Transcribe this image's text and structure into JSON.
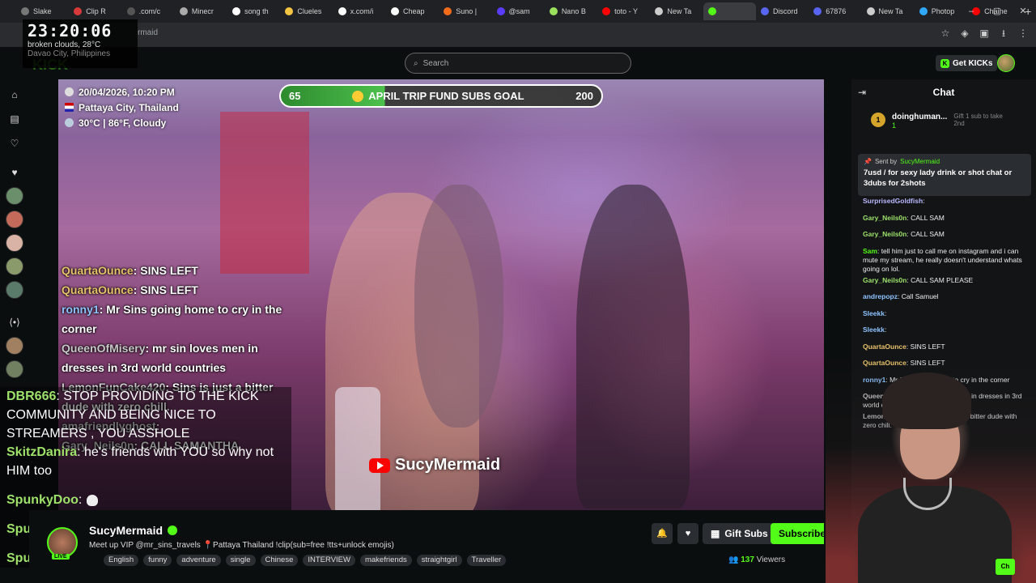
{
  "browser": {
    "tabs": [
      {
        "label": "Slake",
        "color": "#777"
      },
      {
        "label": "Clip R",
        "color": "#d63a3a"
      },
      {
        "label": ".com/c",
        "color": "#555"
      },
      {
        "label": "Minecr",
        "color": "#aaa"
      },
      {
        "label": "song th",
        "color": "#fff"
      },
      {
        "label": "Clueles",
        "color": "#f4c542"
      },
      {
        "label": "x.com/i",
        "color": "#fff"
      },
      {
        "label": "Cheap",
        "color": "#fff"
      },
      {
        "label": "Suno |",
        "color": "#f46b1a"
      },
      {
        "label": "@sam",
        "color": "#5b3cff"
      },
      {
        "label": "Nano B",
        "color": "#9be15d"
      },
      {
        "label": "toto - Y",
        "color": "#ff0000"
      },
      {
        "label": "New Ta",
        "color": "#ccc"
      },
      {
        "label": "",
        "color": "#53fc18"
      },
      {
        "label": "Discord",
        "color": "#5865f2"
      },
      {
        "label": "67876",
        "color": "#5865f2"
      },
      {
        "label": "New Ta",
        "color": "#ccc"
      },
      {
        "label": "Photop",
        "color": "#31a8ff"
      },
      {
        "label": "Chaine",
        "color": "#ff0000"
      }
    ],
    "url": "rmaid",
    "window_controls": [
      "–",
      "▢",
      "✕"
    ]
  },
  "clock": {
    "time": "23:20:06",
    "weather": "broken clouds, 28°C",
    "city": "Davao City, Philippines"
  },
  "site": {
    "logo": "KICK",
    "search_placeholder": "Search",
    "get_kicks": "Get KICKs"
  },
  "stream_overlay": {
    "date": "20/04/2026, 10:20 PM",
    "location": "Pattaya City, Thailand",
    "weather": "30°C | 86°F, Cloudy",
    "goal": {
      "current": "65",
      "label": "APRIL TRIP FUND SUBS GOAL",
      "target": "200",
      "progress": 0.325
    },
    "chat": [
      {
        "user": "QuartaOunce",
        "text": ": SINS LEFT",
        "cls": "n1"
      },
      {
        "user": "QuartaOunce",
        "text": ": SINS LEFT",
        "cls": "n1"
      },
      {
        "user": "ronny1",
        "text": ": Mr Sins going home to cry in the corner",
        "cls": "n2"
      },
      {
        "user": "QueenOfMisery",
        "text": ": mr sin loves men in dresses in 3rd world countries",
        "cls": "n3"
      },
      {
        "user": "LemonFunCake420",
        "text": ": Sins is just a bitter dude with zero chill.",
        "cls": "n3"
      },
      {
        "user": "amafriendlyghost",
        "text": ":",
        "cls": "n3"
      },
      {
        "user": "Gary_Neils0n",
        "text": ": CALL SAMANTHA",
        "cls": "n3"
      }
    ],
    "watermark": "SucyMermaid"
  },
  "external_chat": [
    {
      "user": "DBR666",
      "text": ": STOP PROVIDING TO THE KICK COMMUNITY AND BEING NICE TO STREAMERS , YOU ASSHOLE"
    },
    {
      "user": "SkitzDanira",
      "text": ": he's friends with YOU so why not HIM too"
    },
    {
      "user": "SpunkyDoo",
      "text": ":"
    },
    {
      "user": "SpunkyDoo",
      "text": ":"
    },
    {
      "user": "SpunkyDoo",
      "text": ":"
    }
  ],
  "stream_info": {
    "streamer": "SucyMermaid",
    "live": "LIVE",
    "title": "Meet up VIP @mr_sins_travels 📍Pattaya Thailand !clip(sub=free !tts+unlock emojis)",
    "tags": [
      "English",
      "funny",
      "adventure",
      "single",
      "Chinese",
      "INTERVIEW",
      "makefriends",
      "straightgirl",
      "Traveller"
    ],
    "gift_subs": "Gift Subs",
    "subscribe": "Subscribe",
    "viewers_count": "137",
    "viewers_label": " Viewers"
  },
  "chat": {
    "title": "Chat",
    "leaderboard": {
      "rank": "1",
      "user": "doinghuman...",
      "count": "1",
      "gift_text": "Gift 1 sub to take 2nd"
    },
    "pinned": {
      "sent_by": "Sent by",
      "sender": "SucyMermaid",
      "message": "7usd / for sexy lady drink or shot chat or 3dubs for 2shots"
    },
    "messages": [
      {
        "user": "SurprisedGoldfish",
        "text": ":",
        "color": "#b9b9ff"
      },
      {
        "user": "Gary_Neils0n",
        "text": ": CALL SAM",
        "color": "#9ee26a"
      },
      {
        "user": "Gary_Neils0n",
        "text": ": CALL SAM",
        "color": "#9ee26a"
      },
      {
        "user": "Sam",
        "text": ": tell him just to call me on instagram and i can mute my stream, he really doesn't understand whats going on lol.",
        "color": "#53fc18"
      },
      {
        "user": "Gary_Neils0n",
        "text": ": CALL SAM PLEASE",
        "color": "#9ee26a"
      },
      {
        "user": "andrepopz",
        "text": ": Call Samuel",
        "color": "#8fc4ff"
      },
      {
        "user": "Sleekk",
        "text": ":",
        "color": "#8fc4ff"
      },
      {
        "user": "Sleekk",
        "text": ":",
        "color": "#8fc4ff"
      },
      {
        "user": "QuartaOunce",
        "text": ": SINS LEFT",
        "color": "#e8c26a"
      },
      {
        "user": "QuartaOunce",
        "text": ": SINS LEFT",
        "color": "#e8c26a"
      },
      {
        "user": "ronny1",
        "text": ": Mr Sins going home to cry in the corner",
        "color": "#8fc4ff"
      },
      {
        "user": "QueenOfMisery",
        "text": ": mr sin loves men in dresses in 3rd world countries",
        "color": "#c8c8c8"
      },
      {
        "user": "LemonFunCake420",
        "text": ": Sins is just a bitter dude with zero chill.",
        "color": "#c8c8c8"
      }
    ],
    "send_btn": "Ch"
  }
}
